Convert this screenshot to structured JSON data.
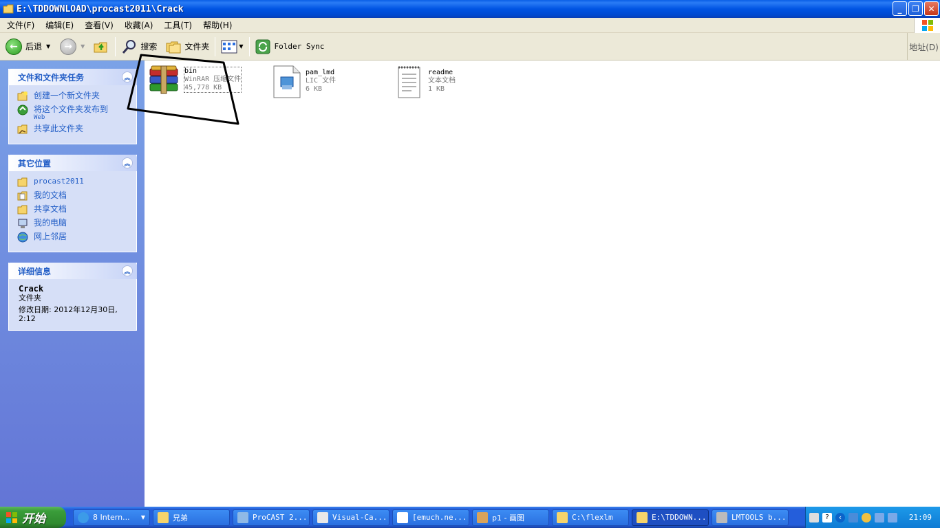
{
  "window": {
    "title": "E:\\TDDOWNLOAD\\procast2011\\Crack",
    "controls": [
      "minimize",
      "restore",
      "close"
    ]
  },
  "menubar": {
    "items": [
      "文件(F)",
      "编辑(E)",
      "查看(V)",
      "收藏(A)",
      "工具(T)",
      "帮助(H)"
    ]
  },
  "toolbar": {
    "back_label": "后退",
    "search_label": "搜索",
    "folders_label": "文件夹",
    "folder_sync_label": "Folder Sync",
    "address_label": "地址(D)"
  },
  "taskpane": {
    "file_tasks": {
      "title": "文件和文件夹任务",
      "items": [
        "创建一个新文件夹",
        "将这个文件夹发布到",
        "共享此文件夹"
      ],
      "web_sub": "Web"
    },
    "other_places": {
      "title": "其它位置",
      "items": [
        "procast2011",
        "我的文档",
        "共享文档",
        "我的电脑",
        "网上邻居"
      ]
    },
    "details": {
      "title": "详细信息",
      "name": "Crack",
      "type": "文件夹",
      "modified": "修改日期: 2012年12月30日,",
      "modified_time": "2:12"
    }
  },
  "files": [
    {
      "name": "bin",
      "type": "WinRAR 压缩文件",
      "size": "45,778 KB",
      "icon": "winrar-icon",
      "selected": true
    },
    {
      "name": "pam_lmd",
      "type": "LIC 文件",
      "size": "6 KB",
      "icon": "lic-file-icon"
    },
    {
      "name": "readme",
      "type": "文本文档",
      "size": "1 KB",
      "icon": "text-document-icon"
    }
  ],
  "taskbar": {
    "start_label": "开始",
    "tasks": [
      {
        "label": "8 Intern...",
        "icon": "ie-icon"
      },
      {
        "label": "兄弟",
        "icon": "folder-icon"
      },
      {
        "label": "ProCAST 2...",
        "icon": "procast-icon"
      },
      {
        "label": "Visual-Ca...",
        "icon": "app-icon"
      },
      {
        "label": "[emuch.ne...",
        "icon": "word-icon"
      },
      {
        "label": "p1 - 画图",
        "icon": "paint-icon"
      },
      {
        "label": "C:\\flexlm",
        "icon": "folder-icon"
      },
      {
        "label": "E:\\TDDOWN...",
        "icon": "folder-icon",
        "active": true
      },
      {
        "label": "LMTOOLS b...",
        "icon": "app-icon"
      }
    ],
    "clock": "21:09"
  },
  "colors": {
    "title_bar": "#0054e3",
    "task_pane_link": "#215dc6",
    "taskbar": "#245edb",
    "start_button": "#3a9d3a",
    "annotation_stroke": "#000000"
  }
}
